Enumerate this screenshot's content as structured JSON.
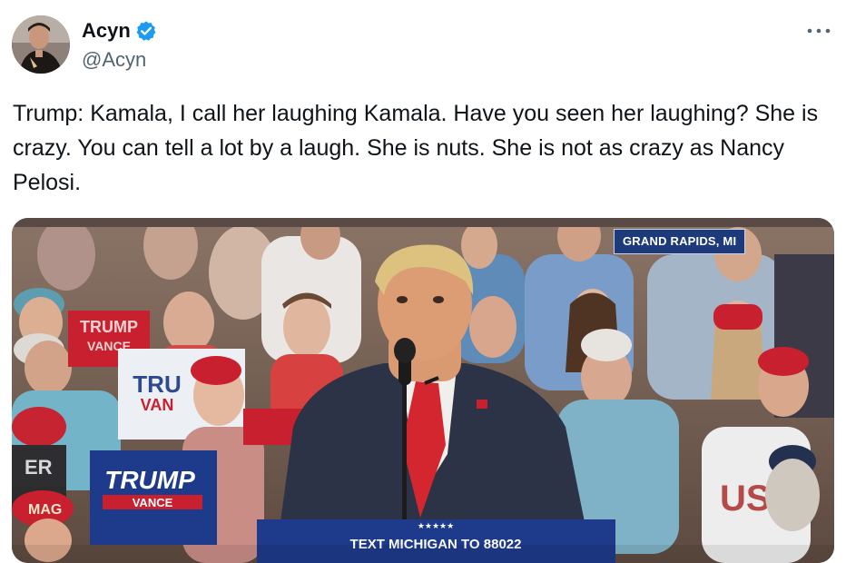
{
  "author": {
    "name": "Acyn",
    "handle": "@Acyn",
    "verified": true,
    "avatar_icon": "avatar-photo"
  },
  "menu": {
    "icon": "more-horizontal-icon"
  },
  "tweet": {
    "text": "Trump: Kamala, I call her laughing Kamala. Have you seen her laughing? She is crazy. You can tell a lot by a laugh. She is nuts. She is not as crazy as Nancy Pelosi."
  },
  "media": {
    "location_label": "GRAND RAPIDS, MI",
    "signs": {
      "trump_vance_1": "TRUMP",
      "trump_vance_1b": "VANCE",
      "trump_vance_2": "TRU",
      "trump_vance_2b": "VAN",
      "trump_vance_3": "TRUMP",
      "trump_vance_3b": "VANCE",
      "er_sign": "ER",
      "usa_shirt": "USA",
      "maga_hat": "MAG",
      "podium": "TEXT MICHIGAN TO 88022"
    }
  },
  "colors": {
    "verified_blue": "#1d9bf0",
    "secondary_text": "#536471",
    "badge_bg": "#1d3a7a",
    "sign_blue": "#1e3a8a",
    "sign_red": "#c8202f"
  }
}
